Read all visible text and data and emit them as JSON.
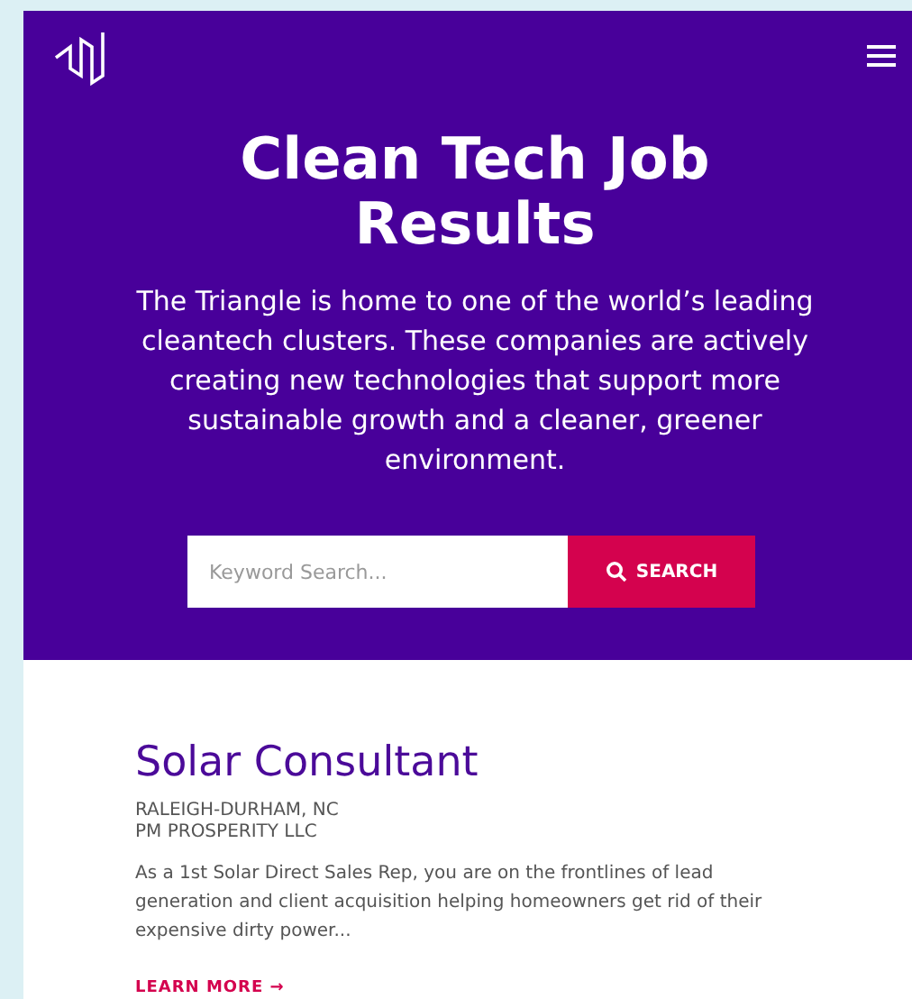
{
  "hero": {
    "title": "Clean Tech Job Results",
    "description": "The Triangle is home to one of the world’s leading cleantech clusters. These companies are actively creating new technologies that support more sustainable growth and a cleaner, greener environment."
  },
  "search": {
    "placeholder": "Keyword Search...",
    "button": "SEARCH"
  },
  "jobs": [
    {
      "title": "Solar Consultant",
      "location": "RALEIGH-DURHAM, NC",
      "company": "PM PROSPERITY LLC",
      "summary": "As a 1st Solar Direct Sales Rep, you are on the frontlines of lead generation and client acquisition helping homeowners get rid of their expensive dirty power...",
      "link": "LEARN MORE →"
    }
  ]
}
